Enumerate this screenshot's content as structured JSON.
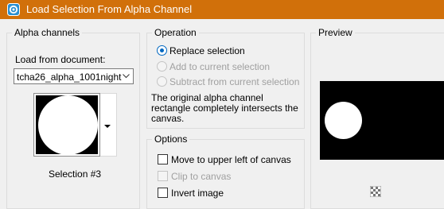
{
  "window": {
    "title": "Load Selection From Alpha Channel",
    "accent": "#d1700a"
  },
  "alpha_channels": {
    "legend": "Alpha channels",
    "load_from_label": "Load from document:",
    "document_value": "tcha26_alpha_1001night",
    "selection_label": "Selection #3"
  },
  "operation": {
    "legend": "Operation",
    "options": [
      {
        "label": "Replace selection",
        "selected": true,
        "enabled": true
      },
      {
        "label": "Add to current selection",
        "selected": false,
        "enabled": false
      },
      {
        "label": "Subtract from current selection",
        "selected": false,
        "enabled": false
      }
    ],
    "note_lines": [
      "The original alpha channel",
      "rectangle completely intersects the",
      "canvas."
    ]
  },
  "options": {
    "legend": "Options",
    "items": [
      {
        "label": "Move to upper left of canvas",
        "checked": false,
        "enabled": true
      },
      {
        "label": "Clip to canvas",
        "checked": false,
        "enabled": false
      },
      {
        "label": "Invert image",
        "checked": false,
        "enabled": true
      }
    ]
  },
  "preview": {
    "legend": "Preview",
    "toggle_icon": "checkerboard-icon"
  }
}
